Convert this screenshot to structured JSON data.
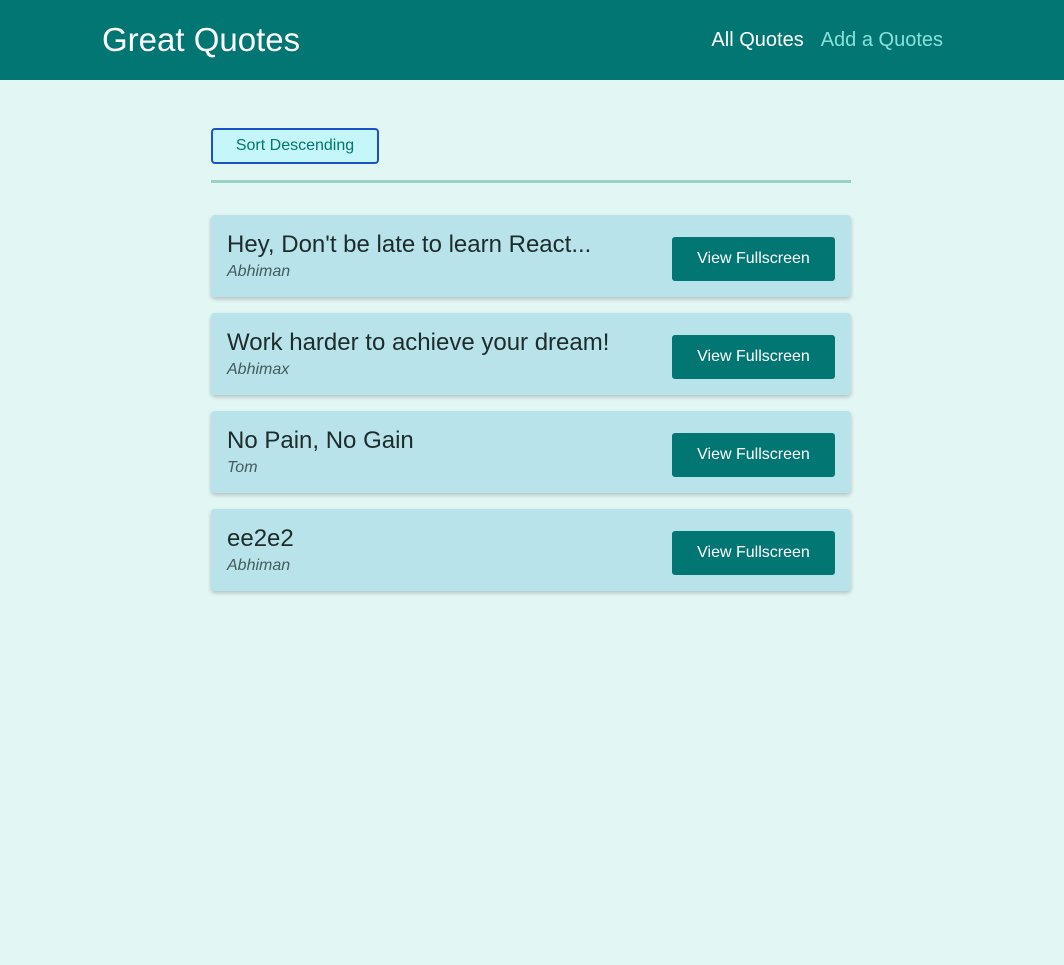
{
  "header": {
    "logo": "Great Quotes",
    "nav": {
      "all_quotes": "All Quotes",
      "add_quote": "Add a Quotes"
    }
  },
  "main": {
    "sort_button_label": "Sort Descending",
    "quotes": [
      {
        "text": "Hey, Don't be late to learn React...",
        "author": "Abhiman",
        "button_label": "View Fullscreen"
      },
      {
        "text": "Work harder to achieve your dream!",
        "author": "Abhimax",
        "button_label": "View Fullscreen"
      },
      {
        "text": "No Pain, No Gain",
        "author": "Tom",
        "button_label": "View Fullscreen"
      },
      {
        "text": "ee2e2",
        "author": "Abhiman",
        "button_label": "View Fullscreen"
      }
    ]
  },
  "colors": {
    "header_bg": "#017672",
    "page_bg": "#e2f6f4",
    "card_bg": "#b8e3ea",
    "nav_active": "#ffffff",
    "nav_inactive": "#87e0dc"
  }
}
